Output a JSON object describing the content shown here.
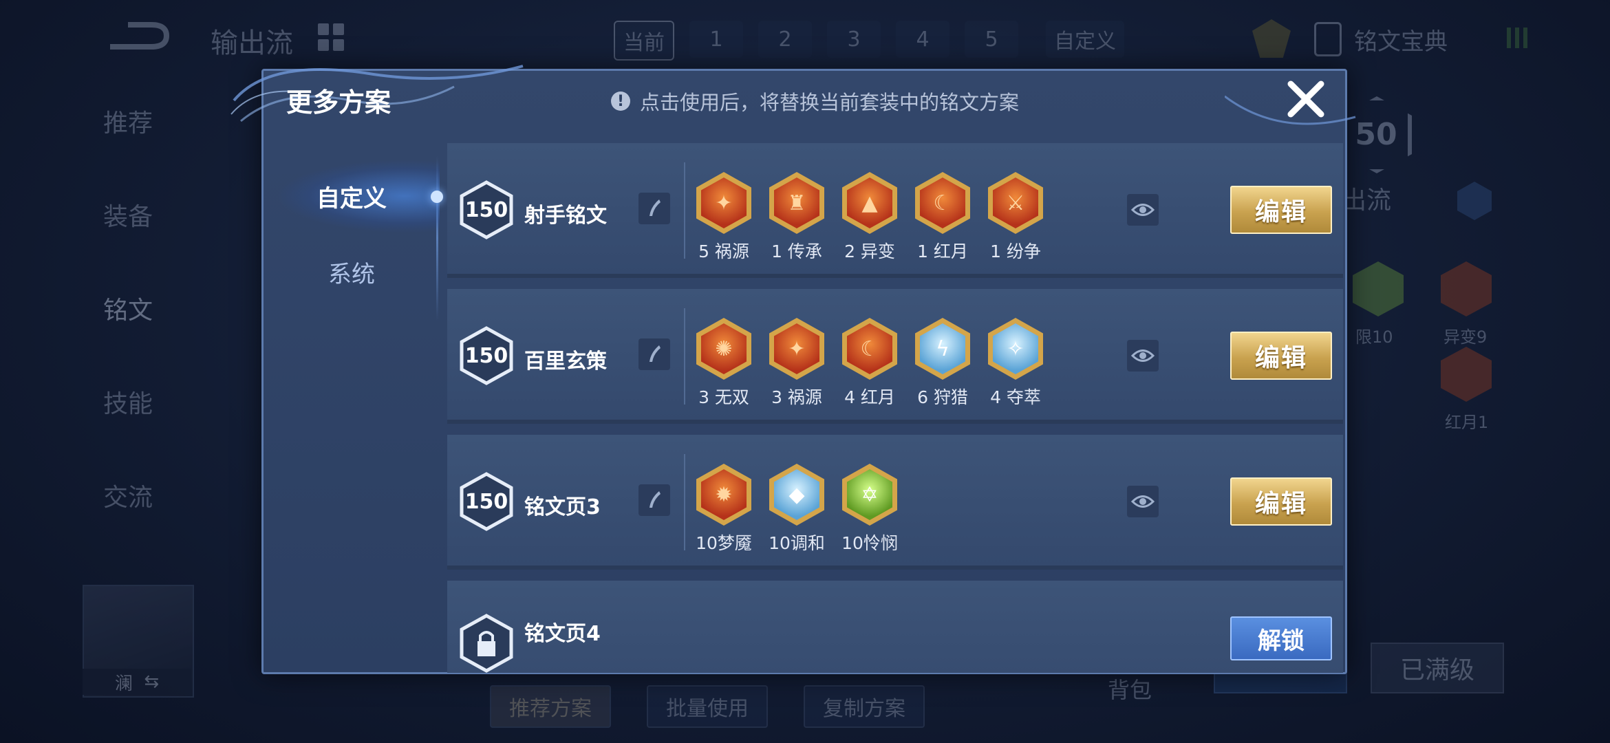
{
  "background": {
    "title": "输出流",
    "top_tabs": [
      "当前",
      "1",
      "2",
      "3",
      "4",
      "5",
      "自定义"
    ],
    "rune_book": "铭文宝典",
    "left_nav": [
      "推荐",
      "装备",
      "铭文",
      "技能",
      "交流"
    ],
    "level_badge": "50",
    "right_label": "出流",
    "right_runes": [
      {
        "label": "限10",
        "color": "#5f8a3a"
      },
      {
        "label": "异变9",
        "color": "#8a3a22"
      },
      {
        "label": "红月1",
        "color": "#8a3a22"
      }
    ],
    "hero_name": "澜",
    "bottom_buttons": [
      "推荐方案",
      "批量使用",
      "复制方案"
    ],
    "bag": "背包",
    "max_level": "已满级"
  },
  "modal": {
    "title": "更多方案",
    "notice": "点击使用后，将替换当前套装中的铭文方案",
    "close_icon": "close-icon",
    "side_tabs": [
      "自定义",
      "系统"
    ],
    "plans": [
      {
        "level": "150",
        "name": "射手铭文",
        "action": "编辑",
        "runes": [
          {
            "label": "5 祸源",
            "tone": "red",
            "glyph": "✦"
          },
          {
            "label": "1 传承",
            "tone": "red",
            "glyph": "♜"
          },
          {
            "label": "2 异变",
            "tone": "red",
            "glyph": "▲"
          },
          {
            "label": "1 红月",
            "tone": "red",
            "glyph": "☾"
          },
          {
            "label": "1 纷争",
            "tone": "red",
            "glyph": "⚔"
          }
        ]
      },
      {
        "level": "150",
        "name": "百里玄策",
        "action": "编辑",
        "runes": [
          {
            "label": "3 无双",
            "tone": "red",
            "glyph": "✺"
          },
          {
            "label": "3 祸源",
            "tone": "red",
            "glyph": "✦"
          },
          {
            "label": "4 红月",
            "tone": "red",
            "glyph": "☾"
          },
          {
            "label": "6 狩猎",
            "tone": "blue",
            "glyph": "ϟ"
          },
          {
            "label": "4 夺萃",
            "tone": "blue",
            "glyph": "✧"
          }
        ]
      },
      {
        "level": "150",
        "name": "铭文页3",
        "action": "编辑",
        "runes": [
          {
            "label": "10梦魇",
            "tone": "red",
            "glyph": "✹"
          },
          {
            "label": "10调和",
            "tone": "blue",
            "glyph": "◆"
          },
          {
            "label": "10怜悯",
            "tone": "green",
            "glyph": "✡"
          }
        ]
      },
      {
        "level": "",
        "name": "铭文页4",
        "action": "解锁",
        "locked": true,
        "runes": []
      }
    ]
  },
  "colors": {
    "gold": "#c9a24f",
    "modal_bg": "#2c3f62",
    "accent_blue": "#5a8fe0"
  }
}
